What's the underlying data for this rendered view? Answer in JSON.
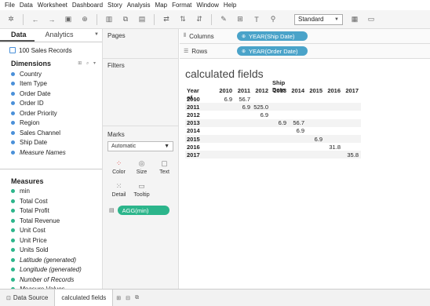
{
  "menu": [
    "File",
    "Data",
    "Worksheet",
    "Dashboard",
    "Story",
    "Analysis",
    "Map",
    "Format",
    "Window",
    "Help"
  ],
  "toolbar": {
    "icons": [
      "tableau-logo-icon",
      "undo-icon",
      "redo-icon",
      "save-icon",
      "add-datasource-icon",
      "new-sheet-icon",
      "duplicate-icon",
      "clear-icon",
      "swap-icon",
      "sort-asc-icon",
      "sort-desc-icon",
      "highlight-icon",
      "group-icon",
      "label-icon",
      "fix-axes-icon",
      "fit-dropdown-icon",
      "show-cards-icon",
      "presentation-icon"
    ],
    "fit_value": "Standard"
  },
  "left_pane": {
    "tab_data": "Data",
    "tab_analytics": "Analytics",
    "datasource": "100 Sales Records",
    "dimensions_title": "Dimensions",
    "dimensions": [
      "Country",
      "Item Type",
      "Order Date",
      "Order ID",
      "Order Priority",
      "Region",
      "Sales Channel",
      "Ship Date",
      "Measure Names"
    ],
    "measures_title": "Measures",
    "measures": [
      "min",
      "Total Cost",
      "Total Profit",
      "Total Revenue",
      "Unit Cost",
      "Unit Price",
      "Units Sold",
      "Latitude (generated)",
      "Longitude (generated)",
      "Number of Records",
      "Measure Values"
    ]
  },
  "cards": {
    "pages": "Pages",
    "filters": "Filters",
    "marks": "Marks",
    "mark_type": "Automatic",
    "buttons": {
      "color": "Color",
      "size": "Size",
      "text": "Text",
      "detail": "Detail",
      "tooltip": "Tooltip"
    },
    "agg_pill": "AGG(min)"
  },
  "shelves": {
    "columns_label": "Columns",
    "columns_pill": "YEAR(Ship Date)",
    "rows_label": "Rows",
    "rows_pill": "YEAR(Order Date)"
  },
  "viz": {
    "title": "calculated fields",
    "col_field": "Ship Date",
    "row_header": "Year of...",
    "columns": [
      "2010",
      "2011",
      "2012",
      "2013",
      "2014",
      "2015",
      "2016",
      "2017"
    ],
    "rows": [
      {
        "year": "2010",
        "cells": [
          "6.9",
          "56.7",
          "",
          "",
          "",
          "",
          "",
          ""
        ]
      },
      {
        "year": "2011",
        "cells": [
          "",
          "6.9",
          "525.0",
          "",
          "",
          "",
          "",
          ""
        ]
      },
      {
        "year": "2012",
        "cells": [
          "",
          "",
          "6.9",
          "",
          "",
          "",
          "",
          ""
        ]
      },
      {
        "year": "2013",
        "cells": [
          "",
          "",
          "",
          "6.9",
          "56.7",
          "",
          "",
          ""
        ]
      },
      {
        "year": "2014",
        "cells": [
          "",
          "",
          "",
          "",
          "6.9",
          "",
          "",
          ""
        ]
      },
      {
        "year": "2015",
        "cells": [
          "",
          "",
          "",
          "",
          "",
          "6.9",
          "",
          ""
        ]
      },
      {
        "year": "2016",
        "cells": [
          "",
          "",
          "",
          "",
          "",
          "",
          "31.8",
          ""
        ]
      },
      {
        "year": "2017",
        "cells": [
          "",
          "",
          "",
          "",
          "",
          "",
          "",
          "35.8"
        ]
      }
    ]
  },
  "bottom": {
    "datasource_tab": "Data Source",
    "sheet_tab": "calculated fields"
  }
}
